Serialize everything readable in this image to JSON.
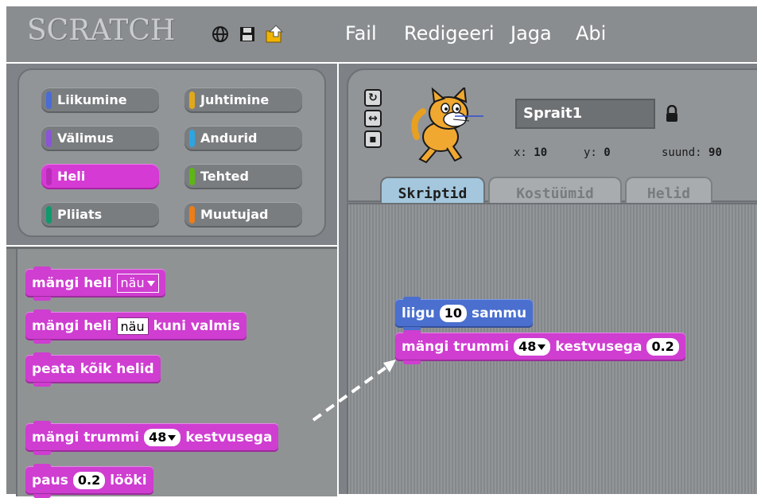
{
  "app": {
    "logo": "SCRATCH"
  },
  "menu": {
    "items": [
      "Fail",
      "Redigeeri",
      "Jaga",
      "Abi"
    ]
  },
  "categories": [
    {
      "label": "Liikumine",
      "color": "#4a6cd4"
    },
    {
      "label": "Juhtimine",
      "color": "#e1a91a"
    },
    {
      "label": "Välimus",
      "color": "#8a55d7"
    },
    {
      "label": "Andurid",
      "color": "#2ca5e2"
    },
    {
      "label": "Heli",
      "color": "#cf3dd1",
      "active": true
    },
    {
      "label": "Tehted",
      "color": "#5cb712"
    },
    {
      "label": "Pliiats",
      "color": "#0e9a6c"
    },
    {
      "label": "Muutujad",
      "color": "#ee7d16"
    }
  ],
  "palette": {
    "block1": {
      "label": "mängi heli",
      "dropdown": "näu"
    },
    "block2": {
      "prefix": "mängi heli",
      "value": "näu",
      "suffix": "kuni valmis"
    },
    "block3": {
      "label": "peata kõik helid"
    },
    "block4": {
      "prefix": "mängi trummi",
      "value": "48",
      "suffix": "kestvusega"
    },
    "block5": {
      "prefix": "paus",
      "value": "0.2",
      "suffix": "lööki"
    }
  },
  "sprite": {
    "name": "Sprait1",
    "x_label": "x:",
    "x_value": "10",
    "y_label": "y:",
    "y_value": "0",
    "dir_label": "suund:",
    "dir_value": "90"
  },
  "tabs": [
    {
      "label": "Skriptid",
      "active": true
    },
    {
      "label": "Kostüümid",
      "active": false
    },
    {
      "label": "Helid",
      "active": false
    }
  ],
  "script": {
    "move": {
      "prefix": "liigu",
      "value": "10",
      "suffix": "sammu"
    },
    "drum": {
      "prefix": "mängi trummi",
      "value": "48",
      "mid": "kestvusega",
      "duration": "0.2"
    }
  },
  "colors": {
    "sound": "#cf3dd1",
    "motion": "#4a6fcf",
    "panel": "#929598"
  }
}
